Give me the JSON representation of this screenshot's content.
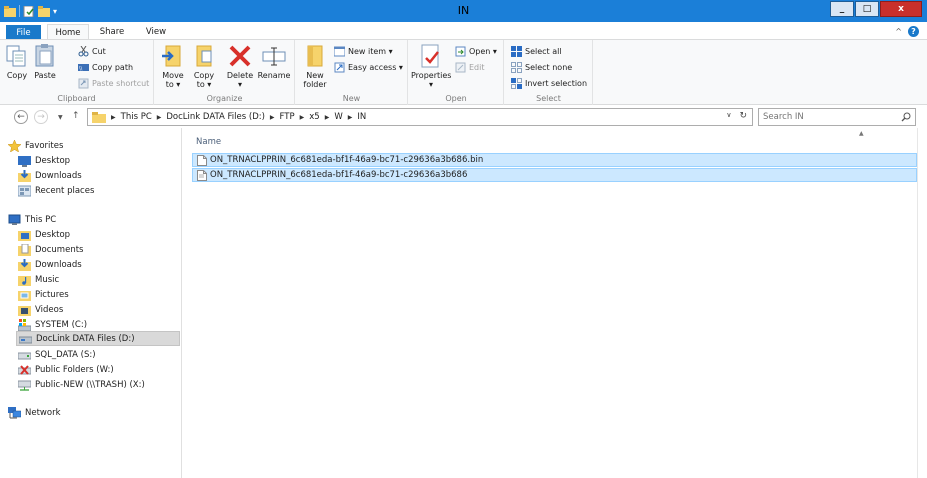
{
  "window": {
    "title": "IN",
    "controls": {
      "minimize": "_",
      "maximize": "□",
      "close": "x"
    }
  },
  "tabs": {
    "file": "File",
    "home": "Home",
    "share": "Share",
    "view": "View"
  },
  "ribbon": {
    "clipboard": {
      "label": "Clipboard",
      "copy": "Copy",
      "paste": "Paste",
      "cut": "Cut",
      "copy_path": "Copy path",
      "paste_shortcut": "Paste shortcut"
    },
    "organize": {
      "label": "Organize",
      "move_to": "Move to ▾",
      "copy_to": "Copy to ▾",
      "delete": "Delete ▾",
      "rename": "Rename"
    },
    "new": {
      "label": "New",
      "new_folder": "New folder",
      "new_item": "New item ▾",
      "easy_access": "Easy access ▾"
    },
    "open": {
      "label": "Open",
      "properties": "Properties ▾",
      "open": "Open ▾",
      "edit": "Edit"
    },
    "select": {
      "label": "Select",
      "select_all": "Select all",
      "select_none": "Select none",
      "invert_selection": "Invert selection"
    }
  },
  "address": {
    "crumbs": [
      "This PC",
      "DocLink DATA Files (D:)",
      "FTP",
      "x5",
      "W",
      "IN"
    ]
  },
  "search": {
    "placeholder": "Search IN"
  },
  "navpane": {
    "favorites": "Favorites",
    "fav_items": [
      "Desktop",
      "Downloads",
      "Recent places"
    ],
    "this_pc": "This PC",
    "pc_items": [
      "Desktop",
      "Documents",
      "Downloads",
      "Music",
      "Pictures",
      "Videos",
      "SYSTEM (C:)",
      "DocLink DATA Files (D:)",
      "SQL_DATA (S:)",
      "Public Folders (W:)",
      "Public-NEW (\\\\TRASH) (X:)"
    ],
    "network": "Network"
  },
  "content": {
    "column_name": "Name",
    "files": [
      "ON_TRNACLPPRIN_6c681eda-bf1f-46a9-bc71-c29636a3b686.bin",
      "ON_TRNACLPPRIN_6c681eda-bf1f-46a9-bc71-c29636a3b686"
    ]
  }
}
